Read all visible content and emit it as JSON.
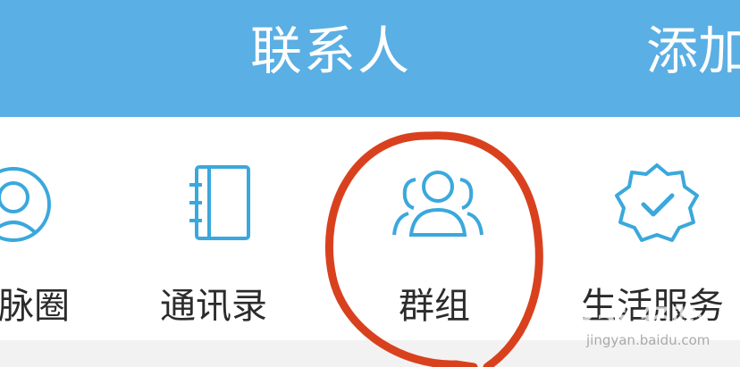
{
  "header": {
    "title": "联系人",
    "add_label": "添加"
  },
  "grid": {
    "items": [
      {
        "label": "脉圈",
        "icon": "circle-profile-icon"
      },
      {
        "label": "通讯录",
        "icon": "address-book-icon"
      },
      {
        "label": "群组",
        "icon": "group-people-icon"
      },
      {
        "label": "生活服务",
        "icon": "verified-badge-icon"
      }
    ]
  },
  "watermark": {
    "brand": "Bai 经验",
    "url": "jingyan.baidu.com"
  },
  "colors": {
    "header_bg": "#5aafe4",
    "icon_stroke": "#3aa8dc",
    "highlight": "#d9411e"
  }
}
